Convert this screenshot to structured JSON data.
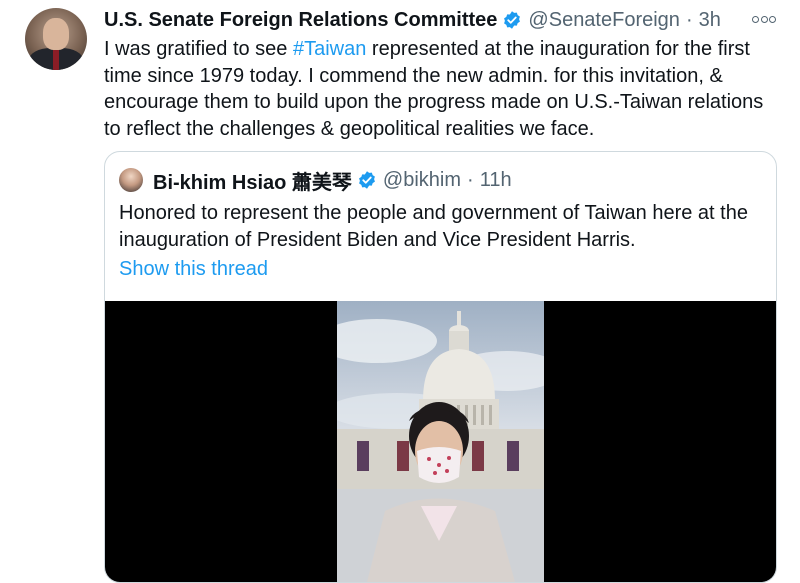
{
  "tweet": {
    "name": "U.S. Senate Foreign Relations Committee",
    "handle": "@SenateForeign",
    "separator": "·",
    "time": "3h",
    "text_before": "I was gratified to see ",
    "hashtag": "#Taiwan",
    "text_after": " represented at the inauguration for the first time since 1979 today. I commend the new admin. for this invitation, & encourage them to build upon the progress made on U.S.-Taiwan relations to reflect the challenges & geopolitical realities we face."
  },
  "quoted": {
    "name": "Bi-khim Hsiao 蕭美琴",
    "handle": "@bikhim",
    "separator": "·",
    "time": "11h",
    "text": "Honored to represent the people and government of Taiwan here at the inauguration of President Biden and Vice President Harris.",
    "show_thread": "Show this thread"
  },
  "icons": {
    "verified": "verified-badge-icon",
    "more": "more-options-icon"
  },
  "colors": {
    "link": "#1d9bf0",
    "secondary_text": "#536471",
    "border": "#cfd9de"
  }
}
